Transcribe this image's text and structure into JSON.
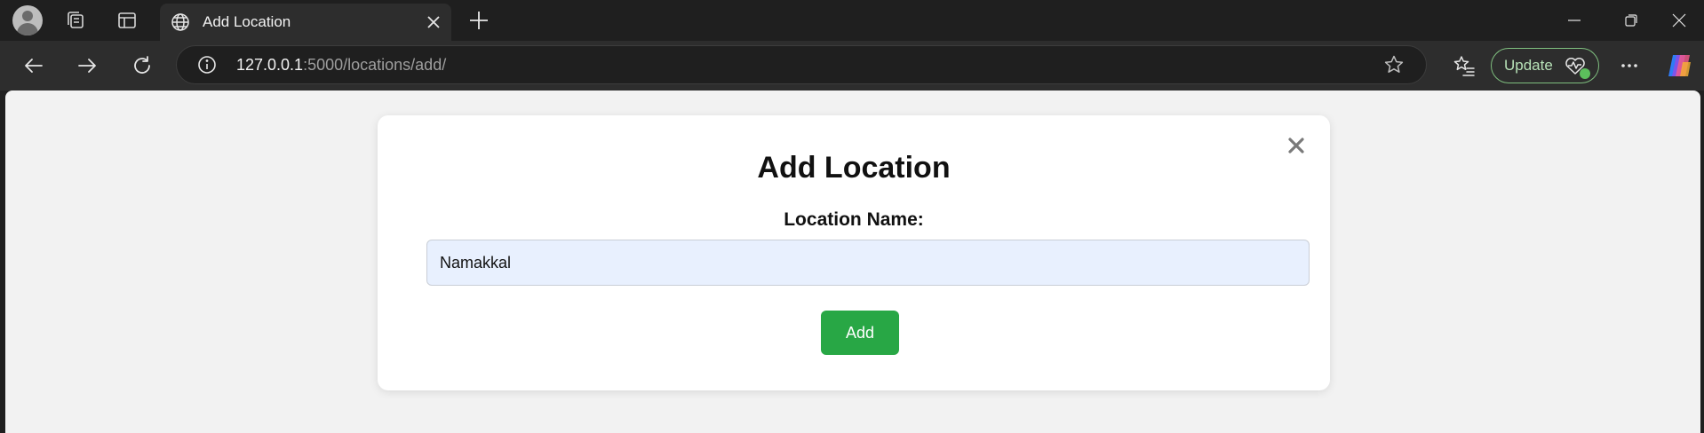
{
  "browser": {
    "tab": {
      "title": "Add Location"
    },
    "address": {
      "host": "127.0.0.1",
      "path": ":5000/locations/add/"
    },
    "update_label": "Update"
  },
  "form": {
    "title": "Add Location",
    "field_label": "Location Name:",
    "location_value": "Namakkal",
    "submit_label": "Add"
  },
  "colors": {
    "submit_button": "#28a745",
    "input_autofill_bg": "#e8f0fe",
    "page_bg": "#f2f2f2"
  }
}
